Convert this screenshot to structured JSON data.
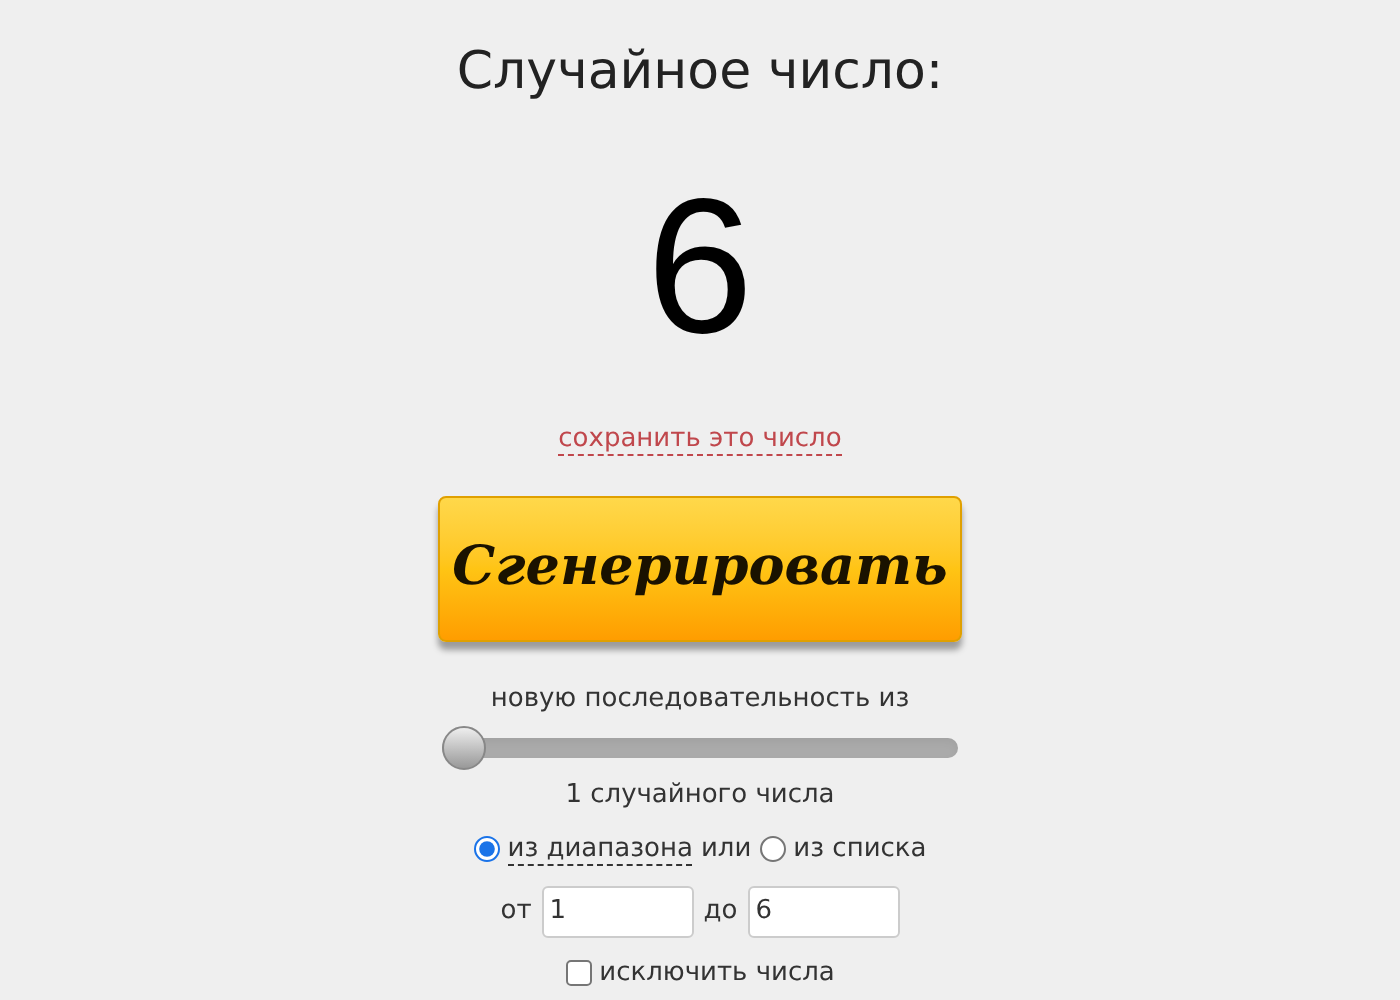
{
  "title": "Случайное число:",
  "result": "6",
  "save_link": "сохранить это число",
  "generate_button": "Сгенерировать",
  "sequence_label": "новую последовательность из",
  "count_slider": {
    "level": 0
  },
  "count_label": "1 случайного числа",
  "source_options": [
    {
      "label": "из диапазона",
      "selected": true
    },
    {
      "label": "из списка",
      "selected": false
    }
  ],
  "source_conjunction": "или",
  "range": {
    "from_label": "от",
    "from_value": "1",
    "to_label": "до",
    "to_value": "6"
  },
  "exclude": {
    "label": "исключить числа",
    "checked": false
  }
}
